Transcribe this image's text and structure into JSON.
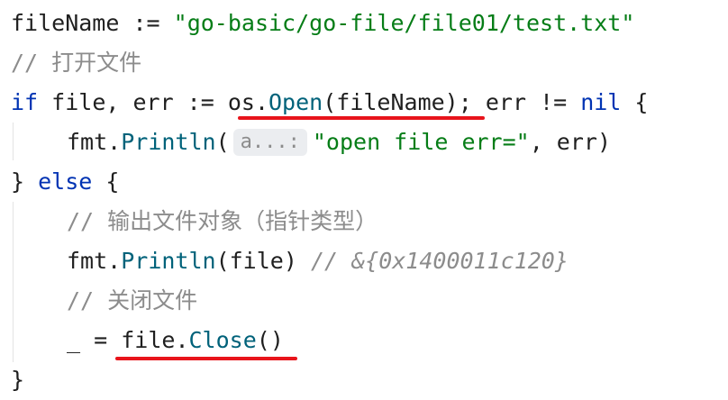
{
  "code": {
    "line1": {
      "var": "fileName",
      "op": " := ",
      "value": "\"go-basic/go-file/file01/test.txt\""
    },
    "line2": {
      "comment": "// 打开文件"
    },
    "line3": {
      "kw_if": "if",
      "vars": " file, err := ",
      "pkg": "os",
      "dot": ".",
      "fn": "Open",
      "args": "(fileName)",
      "rest": "; err != ",
      "kw_nil": "nil",
      "brace": " {"
    },
    "line4": {
      "pkg": "fmt",
      "dot": ".",
      "fn": "Println",
      "paren": "(",
      "hint": "a...:",
      "str": "\"open file err=\"",
      "rest": ", err)"
    },
    "line5": {
      "brace_open": "} ",
      "kw_else": "else",
      "brace": " {"
    },
    "line6": {
      "comment": "// 输出文件对象（指针类型）"
    },
    "line7": {
      "pkg": "fmt",
      "dot": ".",
      "fn": "Println",
      "args": "(file) ",
      "comment": "// &{0x1400011c120}"
    },
    "line8": {
      "comment": "// 关闭文件"
    },
    "line9": {
      "blank": "_ = ",
      "obj": "file",
      "dot": ".",
      "fn": "Close",
      "args": "()"
    },
    "line10": {
      "brace": "}"
    }
  },
  "colors": {
    "keyword": "#0033b3",
    "string": "#067d17",
    "comment": "#8c8c8c",
    "function": "#00627a",
    "annotation_underline": "#e8141b",
    "hint_background": "#ebedf0"
  }
}
